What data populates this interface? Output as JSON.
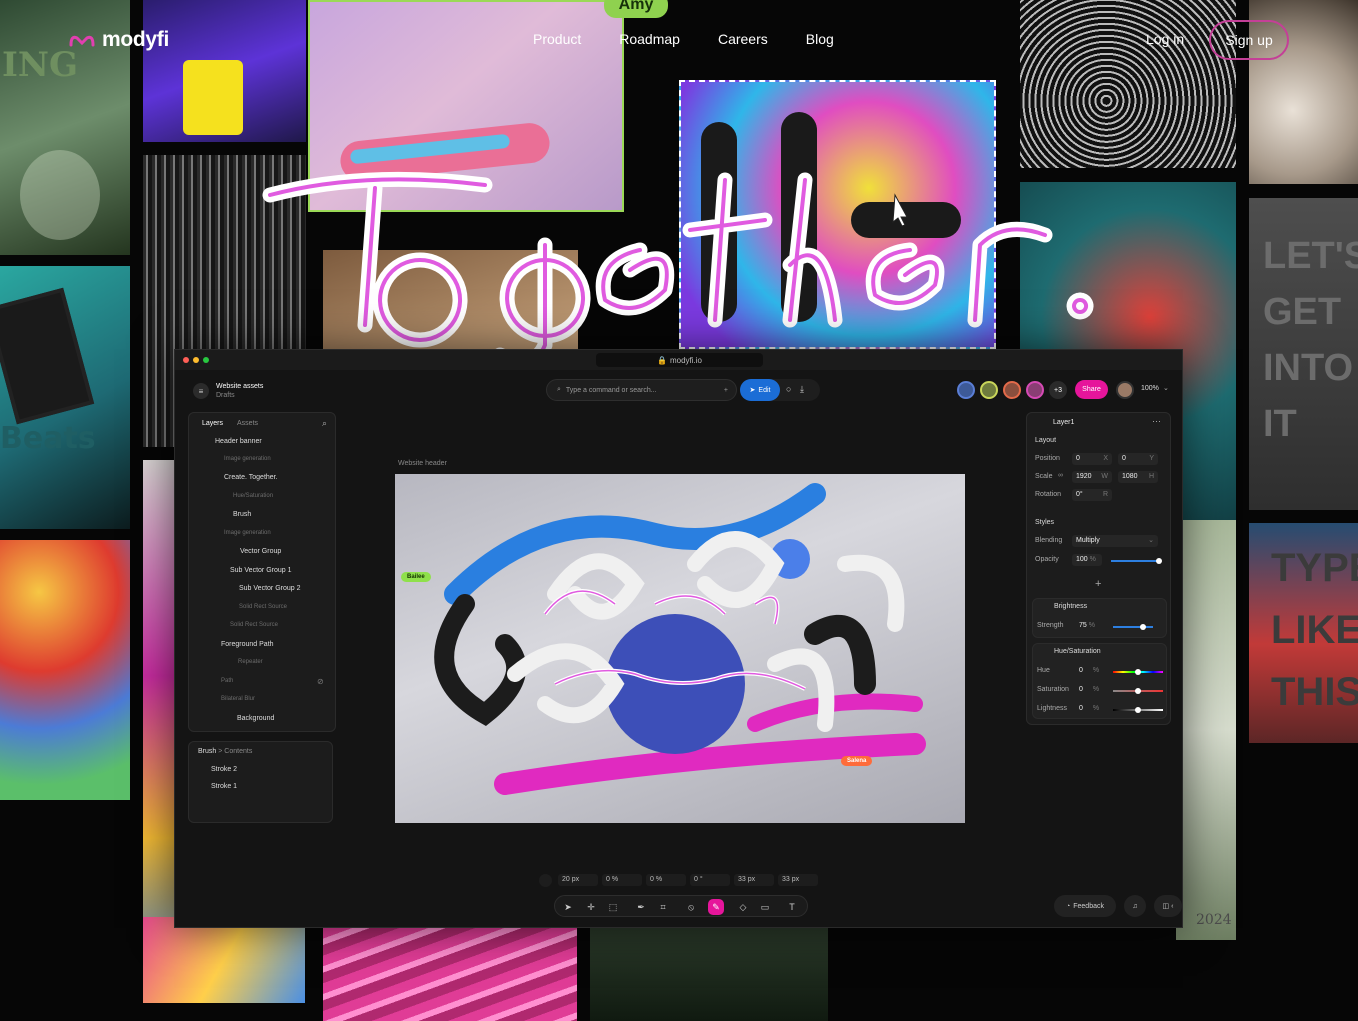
{
  "brand": {
    "name": "modyfi",
    "accent": "#e23fb0"
  },
  "nav": {
    "links": [
      "Product",
      "Roadmap",
      "Careers",
      "Blog"
    ],
    "login": "Log in",
    "signup": "Sign up"
  },
  "hero": {
    "cursor_name": "Amy"
  },
  "app": {
    "url": "modyfi.io",
    "project_title": "Website assets",
    "project_status": "Drafts",
    "search_placeholder": "Type a command or search...",
    "edit_label": "Edit",
    "extra_users": "+3",
    "share_label": "Share",
    "zoom": "100%",
    "layers_tab": "Layers",
    "assets_tab": "Assets",
    "layers": [
      "Header banner",
      "Image generation",
      "Create. Together.",
      "Hue/Saturation",
      "Brush",
      "Image generation",
      "Vector Group",
      "Sub Vector Group 1",
      "Sub Vector Group 2",
      "Solid Rect Source",
      "Solid Rect Source",
      "Foreground Path",
      "Repeater",
      "Path",
      "Bilateral Blur",
      "Background"
    ],
    "brush_panel": {
      "crumb_a": "Brush",
      "sep": ">",
      "crumb_b": "Contents",
      "strokes": [
        "Stroke 2",
        "Stroke 1"
      ]
    },
    "canvas_label": "Website header",
    "collaborators": {
      "a": "Bailee",
      "b": "Salena"
    },
    "props": {
      "layer_name": "Layer1",
      "layout_h": "Layout",
      "position_l": "Position",
      "pos_x": "0",
      "pos_x_u": "X",
      "pos_y": "0",
      "pos_y_u": "Y",
      "scale_l": "Scale",
      "scale_w": "1920",
      "scale_w_u": "W",
      "scale_h": "1080",
      "scale_h_u": "H",
      "rotation_l": "Rotation",
      "rotation": "0°",
      "rotation_u": "R",
      "styles_h": "Styles",
      "blending_l": "Blending",
      "blending": "Multiply",
      "opacity_l": "Opacity",
      "opacity": "100",
      "opacity_u": "%",
      "opacity_val": 1.0,
      "brightness_h": "Brightness",
      "strength_l": "Strength",
      "strength": "75",
      "strength_u": "%",
      "strength_val": 0.75,
      "huesat_h": "Hue/Saturation",
      "hue_l": "Hue",
      "hue": "0",
      "hue_u": "%",
      "sat_l": "Saturation",
      "sat": "0",
      "sat_u": "%",
      "light_l": "Lightness",
      "light": "0",
      "light_u": "%"
    },
    "bottom_values": [
      "20",
      "px",
      "0",
      "%",
      "0",
      "%",
      "0",
      "°",
      "33",
      "px",
      "33",
      "px"
    ],
    "feedback_label": "Feedback"
  },
  "bg_text": {
    "beats": "Beats",
    "ing": "ING",
    "year": "2024",
    "lets": "LET'S GET INTO IT",
    "type": "TYPE LIKE THIS"
  }
}
